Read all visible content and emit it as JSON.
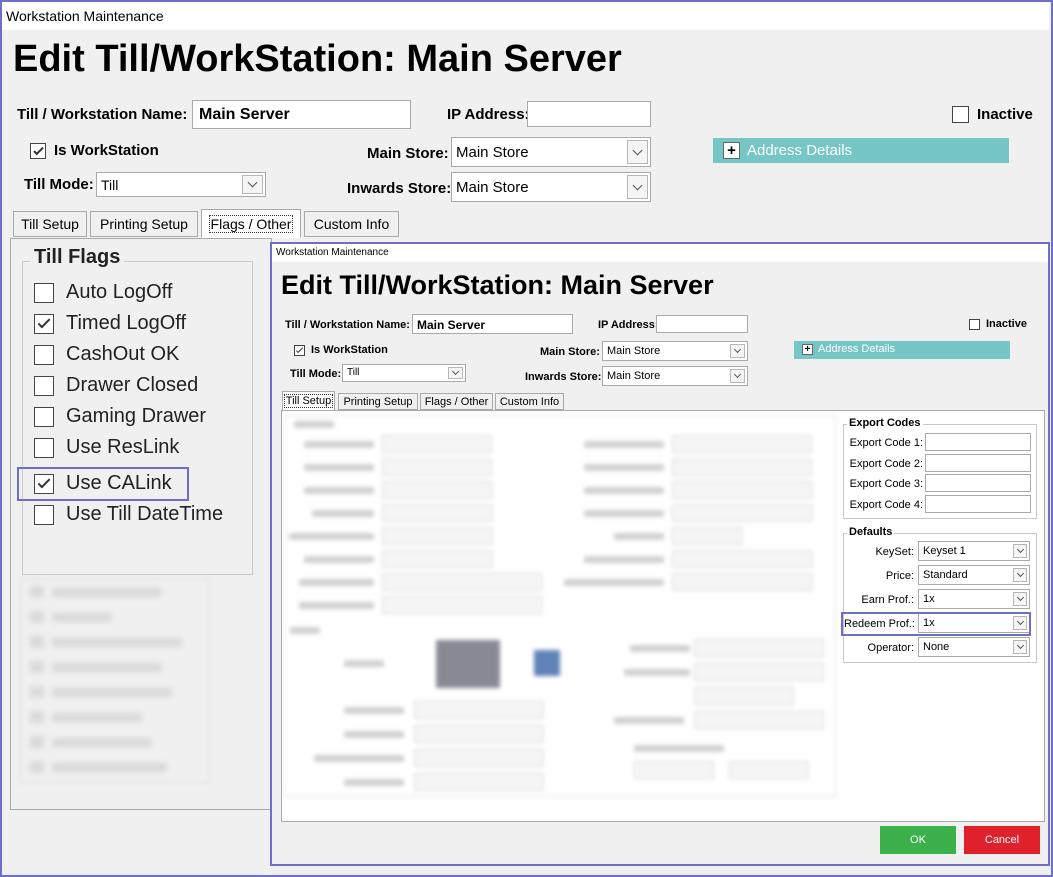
{
  "outer": {
    "window_title": "Workstation Maintenance",
    "heading": "Edit Till/WorkStation: Main Server",
    "name_label": "Till / Workstation Name:",
    "name_value": "Main Server",
    "ip_label": "IP Address:",
    "ip_value": "",
    "inactive_label": "Inactive",
    "is_workstation_label": "Is WorkStation",
    "main_store_label": "Main Store:",
    "main_store_value": "Main Store",
    "inwards_store_label": "Inwards Store:",
    "inwards_store_value": "Main Store",
    "till_mode_label": "Till Mode:",
    "till_mode_value": "Till",
    "address_details": "Address Details",
    "tabs": [
      "Till Setup",
      "Printing Setup",
      "Flags / Other",
      "Custom Info"
    ],
    "till_flags_title": "Till Flags",
    "till_flags": [
      {
        "label": "Auto LogOff",
        "checked": false
      },
      {
        "label": "Timed LogOff",
        "checked": true
      },
      {
        "label": "CashOut OK",
        "checked": false
      },
      {
        "label": "Drawer Closed",
        "checked": false
      },
      {
        "label": "Gaming Drawer",
        "checked": false
      },
      {
        "label": "Use ResLink",
        "checked": false
      },
      {
        "label": "Use CALink",
        "checked": true
      },
      {
        "label": "Use Till DateTime",
        "checked": false
      }
    ]
  },
  "inner": {
    "window_title": "Workstation Maintenance",
    "heading": "Edit Till/WorkStation: Main Server",
    "name_label": "Till / Workstation Name:",
    "name_value": "Main Server",
    "ip_label": "IP Address:",
    "ip_value": "",
    "inactive_label": "Inactive",
    "is_workstation_label": "Is WorkStation",
    "main_store_label": "Main Store:",
    "main_store_value": "Main Store",
    "inwards_store_label": "Inwards Store:",
    "inwards_store_value": "Main Store",
    "till_mode_label": "Till Mode:",
    "till_mode_value": "Till",
    "address_details": "Address Details",
    "tabs": [
      "Till Setup",
      "Printing Setup",
      "Flags / Other",
      "Custom Info"
    ],
    "export_codes_title": "Export Codes",
    "export_codes": [
      "Export Code 1:",
      "Export Code 2:",
      "Export Code 3:",
      "Export Code 4:"
    ],
    "defaults_title": "Defaults",
    "defaults": [
      {
        "label": "KeySet:",
        "value": "Keyset 1"
      },
      {
        "label": "Price:",
        "value": "Standard"
      },
      {
        "label": "Earn Prof.:",
        "value": "1x"
      },
      {
        "label": "Redeem Prof.:",
        "value": "1x"
      },
      {
        "label": "Operator:",
        "value": "None"
      }
    ],
    "ok_label": "OK",
    "cancel_label": "Cancel"
  },
  "colors": {
    "highlight_border": "#6b6fc9",
    "address_bar": "#77c6c6",
    "ok_button": "#3cb04a",
    "cancel_button": "#e0202a"
  }
}
